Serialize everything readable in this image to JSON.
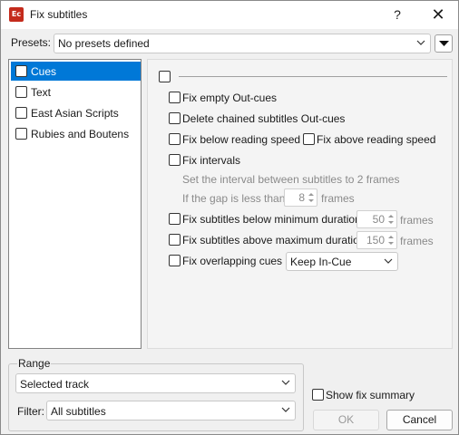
{
  "window": {
    "title": "Fix subtitles",
    "app_icon_text": "Ec",
    "help_glyph": "?",
    "close_glyph": "✕"
  },
  "presets": {
    "label": "Presets:",
    "value": "No presets defined"
  },
  "categories": [
    {
      "label": "Cues",
      "checked": false,
      "selected": true
    },
    {
      "label": "Text",
      "checked": false,
      "selected": false
    },
    {
      "label": "East Asian Scripts",
      "checked": false,
      "selected": false
    },
    {
      "label": "Rubies and Boutens",
      "checked": false,
      "selected": false
    }
  ],
  "cues": {
    "fix_empty_out_cues": "Fix empty Out-cues",
    "delete_chained_out_cues": "Delete chained subtitles Out-cues",
    "fix_below_reading_speed": "Fix below reading speed",
    "fix_above_reading_speed": "Fix above reading speed",
    "fix_intervals": "Fix intervals",
    "interval_desc": "Set the interval between subtitles to 2 frames",
    "gap_label": "If the gap is less than",
    "gap_value": "8",
    "gap_unit": "frames",
    "fix_below_min_duration": "Fix subtitles below minimum duration",
    "min_duration_value": "50",
    "min_duration_unit": "frames",
    "fix_above_max_duration": "Fix subtitles above maximum duration",
    "max_duration_value": "150",
    "max_duration_unit": "frames",
    "fix_overlapping_cues": "Fix overlapping cues",
    "overlap_mode": "Keep In-Cue"
  },
  "range": {
    "label": "Range",
    "track": "Selected track",
    "filter_label": "Filter:",
    "filter_value": "All subtitles"
  },
  "footer": {
    "show_fix_summary": "Show fix summary",
    "ok": "OK",
    "cancel": "Cancel"
  },
  "colors": {
    "selection": "#0078d7",
    "app_icon": "#c42b1c",
    "disabled_text": "#8a8a8a"
  }
}
